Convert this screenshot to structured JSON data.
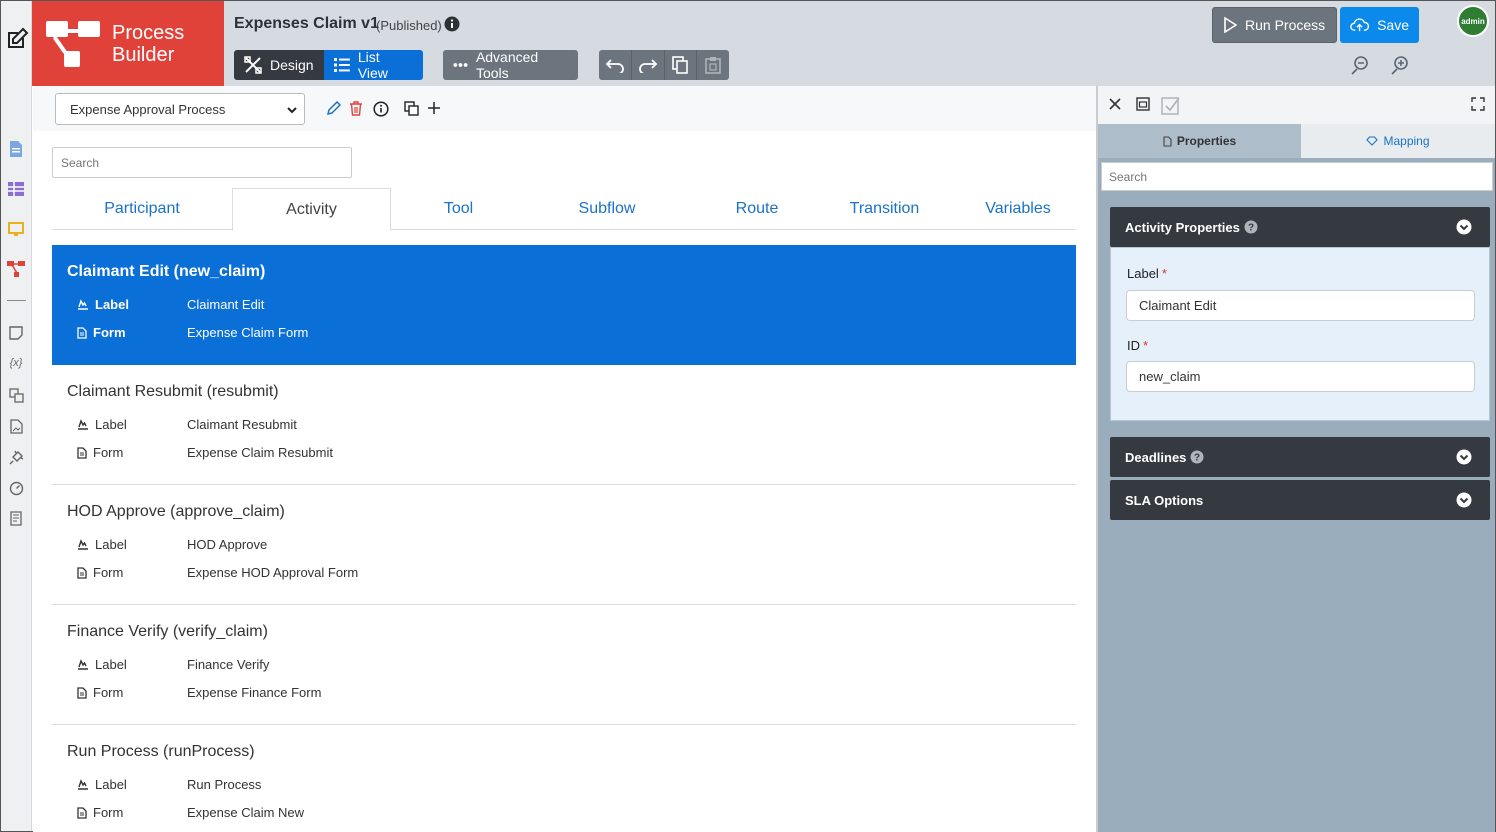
{
  "app": {
    "logo_line1": "Process",
    "logo_line2": "Builder",
    "doc_title": "Expenses Claim v1",
    "doc_status": "(Published)"
  },
  "toolbar": {
    "design_label": "Design",
    "list_view_label": "List View",
    "advanced_label": "Advanced Tools",
    "run_label": "Run Process",
    "save_label": "Save"
  },
  "user": {
    "avatar_text": "admin"
  },
  "process_bar": {
    "selected_process": "Expense Approval Process"
  },
  "main": {
    "search_placeholder": "Search",
    "tabs": [
      {
        "label": "Participant"
      },
      {
        "label": "Activity",
        "active": true
      },
      {
        "label": "Tool"
      },
      {
        "label": "Subflow"
      },
      {
        "label": "Route"
      },
      {
        "label": "Transition"
      },
      {
        "label": "Variables"
      }
    ],
    "field_label_key": "Label",
    "field_form_key": "Form",
    "activities": [
      {
        "title": "Claimant Edit (new_claim)",
        "label": "Claimant Edit",
        "form": "Expense Claim Form",
        "selected": true
      },
      {
        "title": "Claimant Resubmit (resubmit)",
        "label": "Claimant Resubmit",
        "form": "Expense Claim Resubmit"
      },
      {
        "title": "HOD Approve (approve_claim)",
        "label": "HOD Approve",
        "form": "Expense HOD Approval Form"
      },
      {
        "title": "Finance Verify (verify_claim)",
        "label": "Finance Verify",
        "form": "Expense Finance Form"
      },
      {
        "title": "Run Process (runProcess)",
        "label": "Run Process",
        "form": "Expense Claim New"
      }
    ]
  },
  "right_panel": {
    "tab_properties": "Properties",
    "tab_mapping": "Mapping",
    "search_placeholder": "Search",
    "section_activity": "Activity Properties",
    "label_field_label": "Label",
    "label_field_value": "Claimant Edit",
    "id_field_label": "ID",
    "id_field_value": "new_claim",
    "section_deadlines": "Deadlines",
    "section_sla": "SLA Options",
    "required_mark": "*"
  },
  "colors": {
    "brand_red": "#e0423a",
    "primary_blue": "#0b6fd8",
    "save_blue": "#0b8aec",
    "dark": "#343a40",
    "panel_bg": "#9aadbd"
  }
}
